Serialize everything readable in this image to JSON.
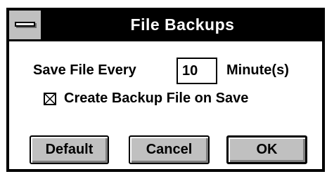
{
  "window": {
    "title": "File Backups"
  },
  "save_interval": {
    "prefix_label": "Save File Every",
    "value": "10",
    "suffix_label": "Minute(s)"
  },
  "backup_option": {
    "checked": true,
    "label": "Create Backup File on Save"
  },
  "buttons": {
    "default_label": "Default",
    "cancel_label": "Cancel",
    "ok_label": "OK"
  },
  "colors": {
    "titlebar": "#000000",
    "button_face": "#c0c0c0",
    "window_bg": "#ffffff"
  }
}
